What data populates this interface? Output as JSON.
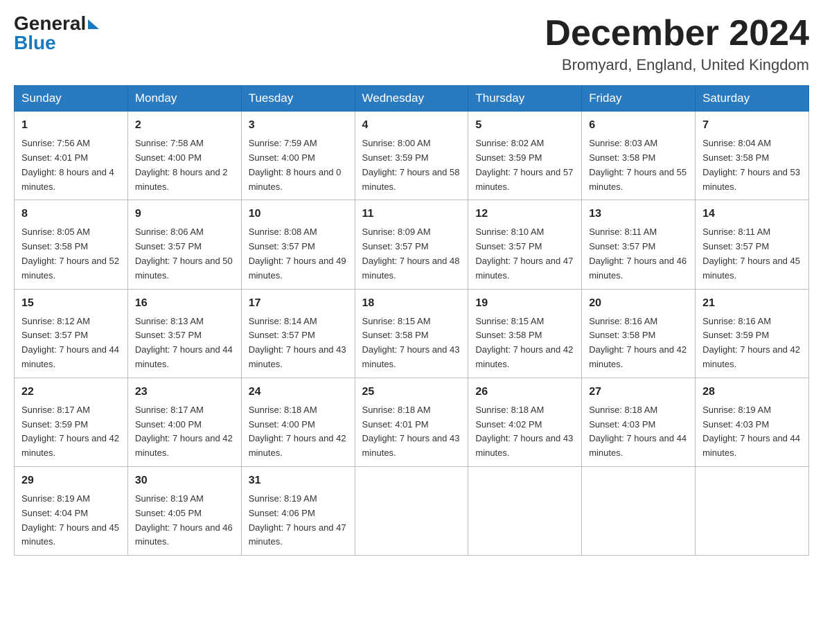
{
  "header": {
    "logo_general": "General",
    "logo_blue": "Blue",
    "month_title": "December 2024",
    "location": "Bromyard, England, United Kingdom"
  },
  "weekdays": [
    "Sunday",
    "Monday",
    "Tuesday",
    "Wednesday",
    "Thursday",
    "Friday",
    "Saturday"
  ],
  "weeks": [
    [
      {
        "day": "1",
        "sunrise": "7:56 AM",
        "sunset": "4:01 PM",
        "daylight": "8 hours and 4 minutes."
      },
      {
        "day": "2",
        "sunrise": "7:58 AM",
        "sunset": "4:00 PM",
        "daylight": "8 hours and 2 minutes."
      },
      {
        "day": "3",
        "sunrise": "7:59 AM",
        "sunset": "4:00 PM",
        "daylight": "8 hours and 0 minutes."
      },
      {
        "day": "4",
        "sunrise": "8:00 AM",
        "sunset": "3:59 PM",
        "daylight": "7 hours and 58 minutes."
      },
      {
        "day": "5",
        "sunrise": "8:02 AM",
        "sunset": "3:59 PM",
        "daylight": "7 hours and 57 minutes."
      },
      {
        "day": "6",
        "sunrise": "8:03 AM",
        "sunset": "3:58 PM",
        "daylight": "7 hours and 55 minutes."
      },
      {
        "day": "7",
        "sunrise": "8:04 AM",
        "sunset": "3:58 PM",
        "daylight": "7 hours and 53 minutes."
      }
    ],
    [
      {
        "day": "8",
        "sunrise": "8:05 AM",
        "sunset": "3:58 PM",
        "daylight": "7 hours and 52 minutes."
      },
      {
        "day": "9",
        "sunrise": "8:06 AM",
        "sunset": "3:57 PM",
        "daylight": "7 hours and 50 minutes."
      },
      {
        "day": "10",
        "sunrise": "8:08 AM",
        "sunset": "3:57 PM",
        "daylight": "7 hours and 49 minutes."
      },
      {
        "day": "11",
        "sunrise": "8:09 AM",
        "sunset": "3:57 PM",
        "daylight": "7 hours and 48 minutes."
      },
      {
        "day": "12",
        "sunrise": "8:10 AM",
        "sunset": "3:57 PM",
        "daylight": "7 hours and 47 minutes."
      },
      {
        "day": "13",
        "sunrise": "8:11 AM",
        "sunset": "3:57 PM",
        "daylight": "7 hours and 46 minutes."
      },
      {
        "day": "14",
        "sunrise": "8:11 AM",
        "sunset": "3:57 PM",
        "daylight": "7 hours and 45 minutes."
      }
    ],
    [
      {
        "day": "15",
        "sunrise": "8:12 AM",
        "sunset": "3:57 PM",
        "daylight": "7 hours and 44 minutes."
      },
      {
        "day": "16",
        "sunrise": "8:13 AM",
        "sunset": "3:57 PM",
        "daylight": "7 hours and 44 minutes."
      },
      {
        "day": "17",
        "sunrise": "8:14 AM",
        "sunset": "3:57 PM",
        "daylight": "7 hours and 43 minutes."
      },
      {
        "day": "18",
        "sunrise": "8:15 AM",
        "sunset": "3:58 PM",
        "daylight": "7 hours and 43 minutes."
      },
      {
        "day": "19",
        "sunrise": "8:15 AM",
        "sunset": "3:58 PM",
        "daylight": "7 hours and 42 minutes."
      },
      {
        "day": "20",
        "sunrise": "8:16 AM",
        "sunset": "3:58 PM",
        "daylight": "7 hours and 42 minutes."
      },
      {
        "day": "21",
        "sunrise": "8:16 AM",
        "sunset": "3:59 PM",
        "daylight": "7 hours and 42 minutes."
      }
    ],
    [
      {
        "day": "22",
        "sunrise": "8:17 AM",
        "sunset": "3:59 PM",
        "daylight": "7 hours and 42 minutes."
      },
      {
        "day": "23",
        "sunrise": "8:17 AM",
        "sunset": "4:00 PM",
        "daylight": "7 hours and 42 minutes."
      },
      {
        "day": "24",
        "sunrise": "8:18 AM",
        "sunset": "4:00 PM",
        "daylight": "7 hours and 42 minutes."
      },
      {
        "day": "25",
        "sunrise": "8:18 AM",
        "sunset": "4:01 PM",
        "daylight": "7 hours and 43 minutes."
      },
      {
        "day": "26",
        "sunrise": "8:18 AM",
        "sunset": "4:02 PM",
        "daylight": "7 hours and 43 minutes."
      },
      {
        "day": "27",
        "sunrise": "8:18 AM",
        "sunset": "4:03 PM",
        "daylight": "7 hours and 44 minutes."
      },
      {
        "day": "28",
        "sunrise": "8:19 AM",
        "sunset": "4:03 PM",
        "daylight": "7 hours and 44 minutes."
      }
    ],
    [
      {
        "day": "29",
        "sunrise": "8:19 AM",
        "sunset": "4:04 PM",
        "daylight": "7 hours and 45 minutes."
      },
      {
        "day": "30",
        "sunrise": "8:19 AM",
        "sunset": "4:05 PM",
        "daylight": "7 hours and 46 minutes."
      },
      {
        "day": "31",
        "sunrise": "8:19 AM",
        "sunset": "4:06 PM",
        "daylight": "7 hours and 47 minutes."
      },
      null,
      null,
      null,
      null
    ]
  ]
}
